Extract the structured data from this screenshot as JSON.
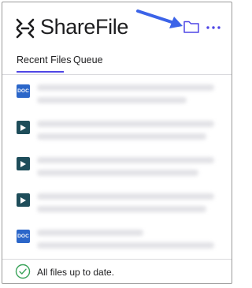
{
  "header": {
    "brand_name": "ShareFile",
    "logo_icon": "sharefile-logo-icon",
    "folder_icon": "folder-icon",
    "more_icon": "more-options-icon",
    "annotation_arrow": "annotation-arrow"
  },
  "tabs": [
    {
      "label": "Recent Files",
      "selected": true
    },
    {
      "label": "Queue",
      "selected": false
    }
  ],
  "files": [
    {
      "type": "doc",
      "badge": "DOC",
      "icon": "doc-file-icon"
    },
    {
      "type": "video",
      "badge": "",
      "icon": "play-video-icon"
    },
    {
      "type": "video",
      "badge": "",
      "icon": "play-video-icon"
    },
    {
      "type": "video",
      "badge": "",
      "icon": "play-video-icon"
    },
    {
      "type": "doc",
      "badge": "DOC",
      "icon": "doc-file-icon"
    }
  ],
  "footer": {
    "status_text": "All files up to date.",
    "status_icon": "check-circle-icon"
  },
  "colors": {
    "accent": "#4f46e5",
    "arrow": "#3b63e8",
    "doc_icon": "#2b66c9",
    "video_icon": "#1e4d5a",
    "status_ok": "#3aa35a"
  }
}
